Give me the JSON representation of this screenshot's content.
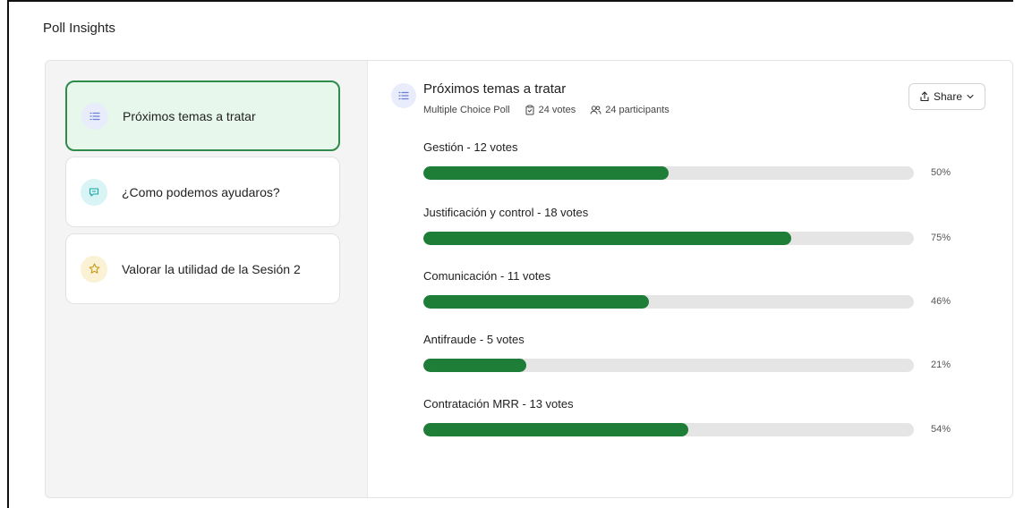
{
  "page": {
    "title": "Poll Insights"
  },
  "sidebar": {
    "items": [
      {
        "label": "Próximos temas a tratar",
        "icon": "list-icon",
        "active": true
      },
      {
        "label": "¿Como podemos ayudaros?",
        "icon": "chat-icon",
        "active": false
      },
      {
        "label": "Valorar la utilidad de la Sesión 2",
        "icon": "star-icon",
        "active": false
      }
    ]
  },
  "poll": {
    "title": "Próximos temas a tratar",
    "type": "Multiple Choice Poll",
    "votes": "24 votes",
    "participants": "24 participants",
    "share_label": "Share",
    "options": [
      {
        "label": "Gestión - 12 votes",
        "percent": "50%",
        "fraction": 0.5
      },
      {
        "label": "Justificación y control - 18 votes",
        "percent": "75%",
        "fraction": 0.75
      },
      {
        "label": "Comunicación - 11 votes",
        "percent": "46%",
        "fraction": 0.46
      },
      {
        "label": "Antifraude - 5 votes",
        "percent": "21%",
        "fraction": 0.21
      },
      {
        "label": "Contratación MRR - 13 votes",
        "percent": "54%",
        "fraction": 0.54
      }
    ]
  },
  "colors": {
    "accent": "#1e7d36",
    "active_card_bg": "#e7f7ec",
    "active_card_border": "#2e8b4a"
  }
}
